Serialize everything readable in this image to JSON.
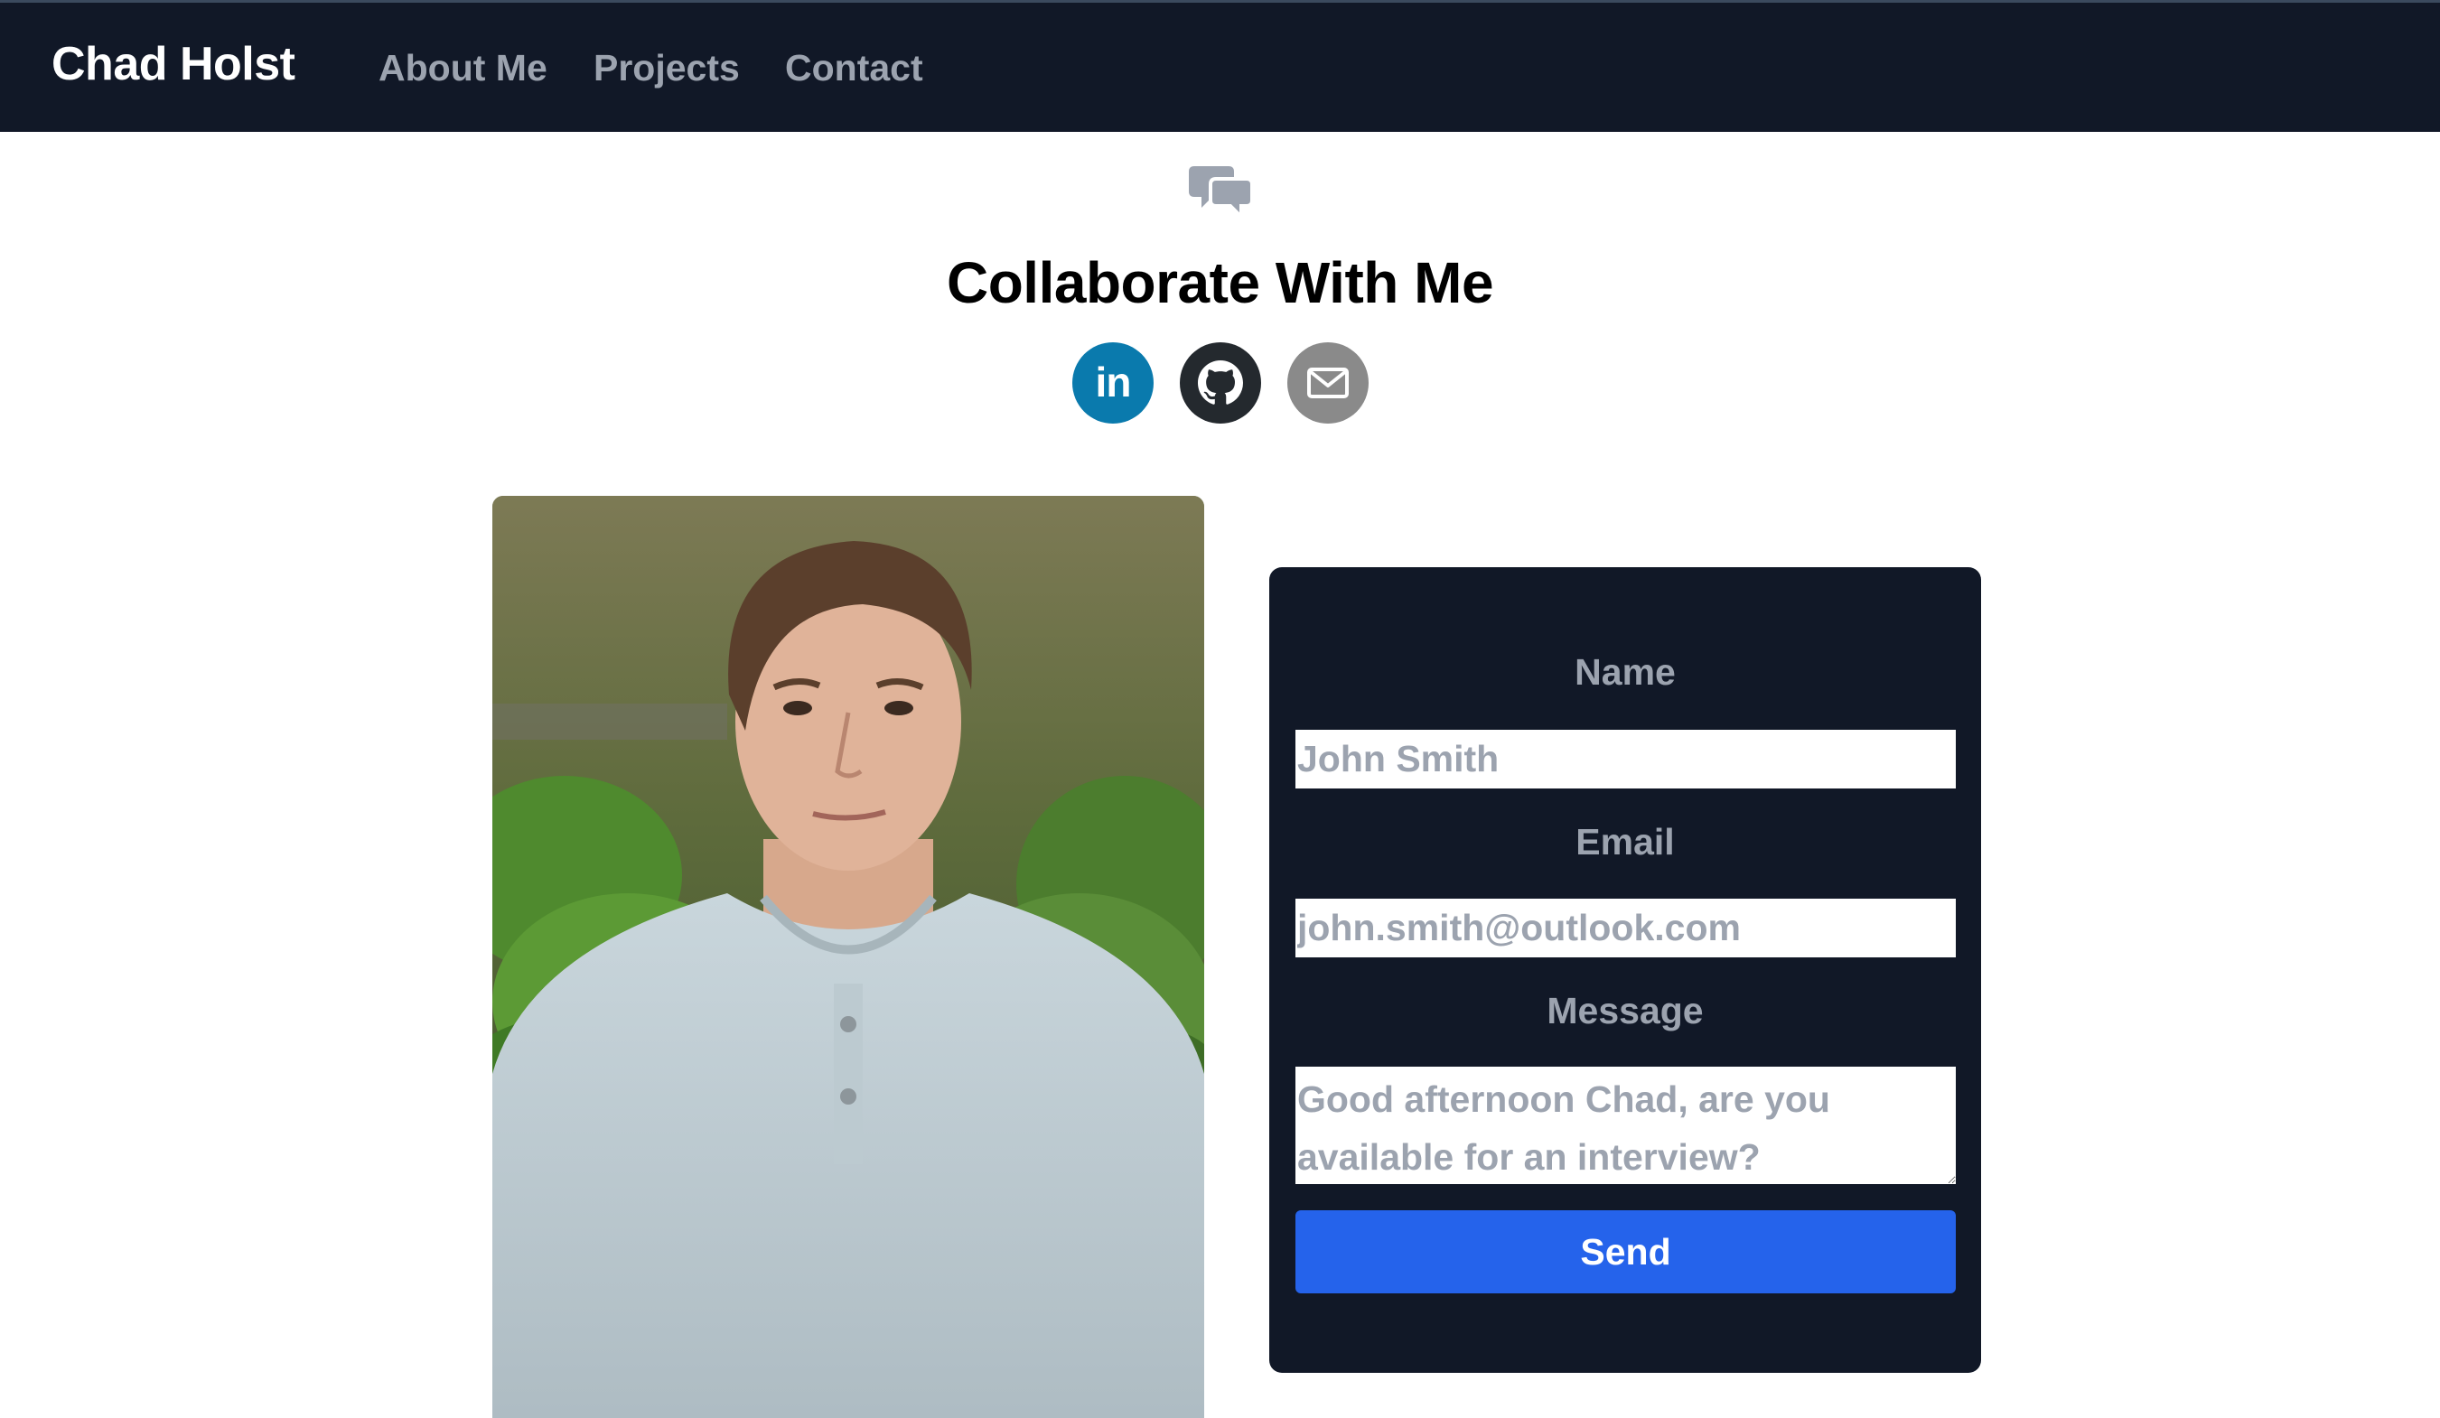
{
  "navbar": {
    "brand": "Chad Holst",
    "links": [
      {
        "label": "About Me"
      },
      {
        "label": "Projects"
      },
      {
        "label": "Contact"
      }
    ],
    "background": "#111827"
  },
  "header": {
    "icon": "chat-bubbles-icon",
    "title": "Collaborate With Me",
    "social": [
      {
        "name": "linkedin",
        "icon": "linkedin-icon",
        "text": "in",
        "color": "#0a7aad"
      },
      {
        "name": "github",
        "icon": "github-icon",
        "color": "#24292e"
      },
      {
        "name": "email",
        "icon": "mail-icon",
        "color": "#8a8a8a"
      }
    ]
  },
  "contact_form": {
    "name_label": "Name",
    "name_placeholder": "John Smith",
    "email_label": "Email",
    "email_placeholder": "john.smith@outlook.com",
    "message_label": "Message",
    "message_placeholder": "Good afternoon Chad, are you available for an interview?",
    "send_label": "Send",
    "accent": "#2563eb"
  }
}
